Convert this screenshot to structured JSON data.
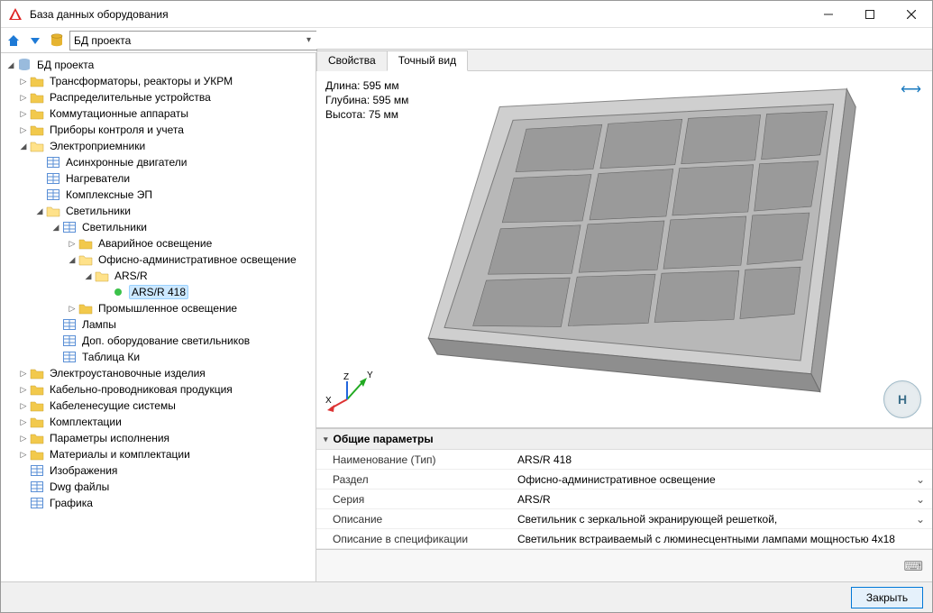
{
  "window_title": "База данных оборудования",
  "toolbar": {
    "combo_value": "БД проекта"
  },
  "tabs": {
    "properties": "Свойства",
    "exact_view": "Точный вид"
  },
  "dimensions": {
    "length": "Длина: 595 мм",
    "depth": "Глубина: 595 мм",
    "height": "Высота: 75 мм"
  },
  "viewcube_letter": "Н",
  "tree": {
    "root": "БД проекта",
    "items": {
      "transformers": "Трансформаторы, реакторы и УКРМ",
      "distribution": "Распределительные устройства",
      "switching": "Коммутационные аппараты",
      "metering": "Приборы контроля и учета",
      "consumers": "Электроприемники",
      "async_motors": "Асинхронные двигатели",
      "heaters": "Нагреватели",
      "complex_ep": "Комплексные ЭП",
      "luminaires": "Светильники",
      "luminaires2": "Светильники",
      "emergency": "Аварийное освещение",
      "office": "Офисно-административное освещение",
      "arsr": "ARS/R",
      "arsr418": "ARS/R 418",
      "industrial": "Промышленное освещение",
      "lamps": "Лампы",
      "lum_extra": "Доп. оборудование светильников",
      "ki_table": "Таблица Ки",
      "install_products": "Электроустановочные изделия",
      "cable_wire": "Кабельно-проводниковая продукция",
      "cable_trays": "Кабеленесущие системы",
      "bundling": "Комплектации",
      "exec_params": "Параметры исполнения",
      "materials": "Материалы и комплектации",
      "images": "Изображения",
      "dwg": "Dwg файлы",
      "graphics": "Графика"
    }
  },
  "props": {
    "header": "Общие параметры",
    "rows": [
      {
        "key": "Наименование (Тип)",
        "val": "ARS/R 418",
        "drop": false
      },
      {
        "key": "Раздел",
        "val": "Офисно-административное освещение",
        "drop": true
      },
      {
        "key": "Серия",
        "val": "ARS/R",
        "drop": true
      },
      {
        "key": "Описание",
        "val": "Светильник с зеркальной экранирующей решеткой,",
        "drop": true
      },
      {
        "key": "Описание в спецификации",
        "val": "Светильник встраиваемый с люминесцентными лампами мощностью 4х18",
        "drop": false
      }
    ]
  },
  "footer": {
    "close": "Закрыть"
  },
  "axis": {
    "x": "X",
    "y": "Y",
    "z": "Z"
  }
}
